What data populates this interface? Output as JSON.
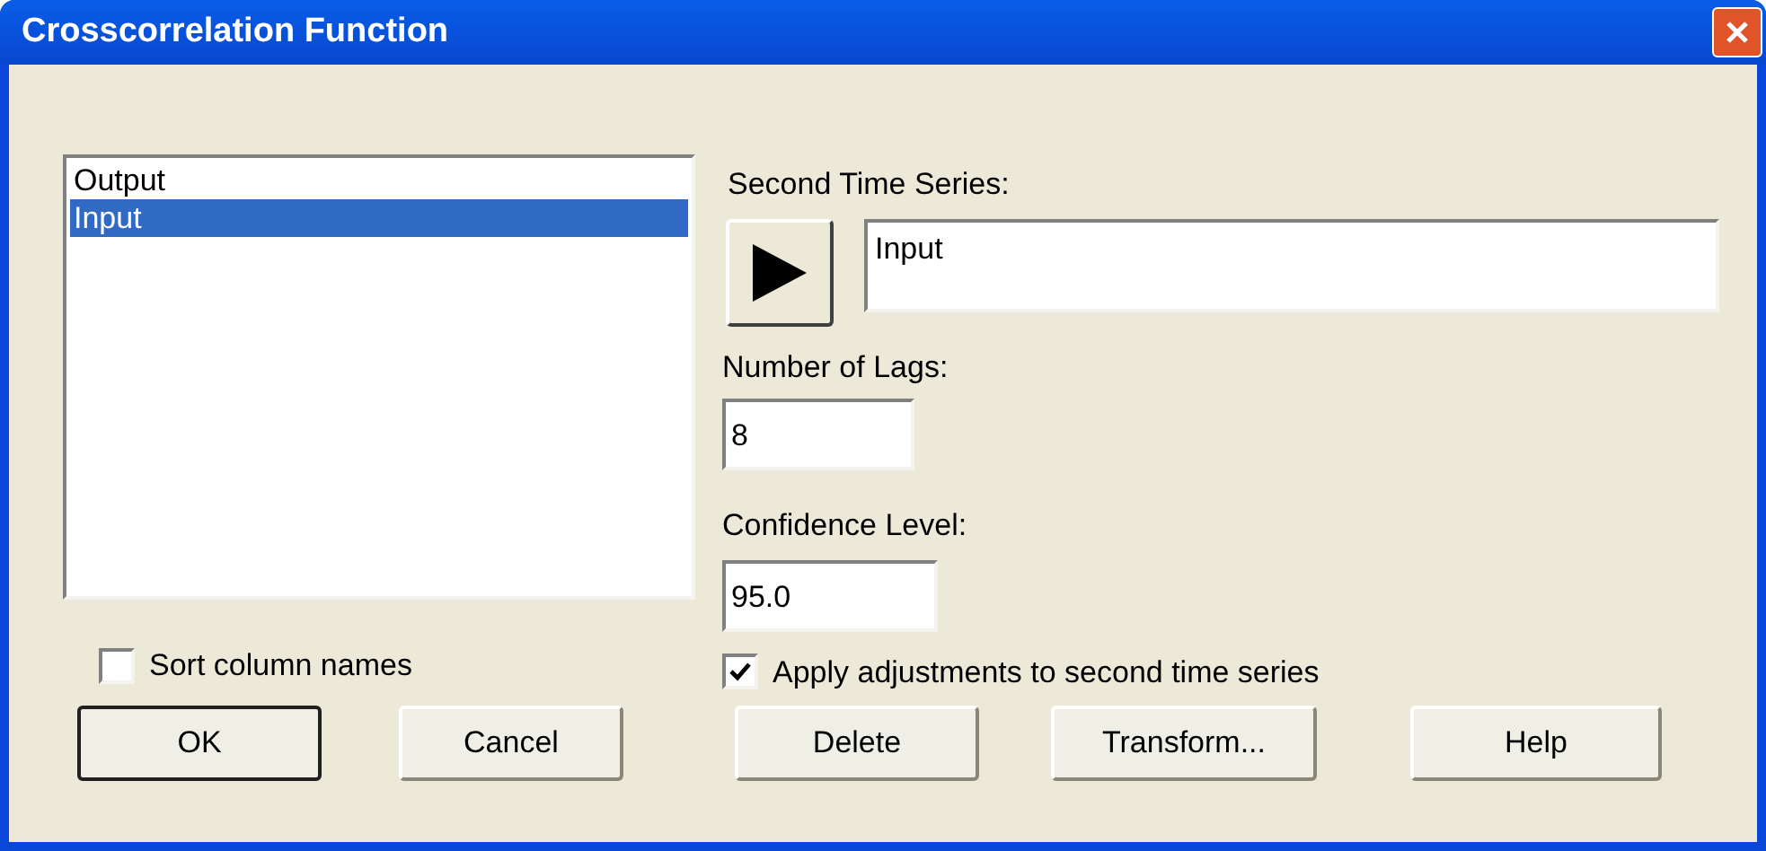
{
  "window": {
    "title": "Crosscorrelation Function"
  },
  "column_list": [
    {
      "label": "Output",
      "selected": false
    },
    {
      "label": "Input",
      "selected": true
    }
  ],
  "sort_column_names": {
    "label": "Sort column names",
    "checked": false
  },
  "second_time_series": {
    "label": "Second Time Series:",
    "value": "Input"
  },
  "number_of_lags": {
    "label": "Number of Lags:",
    "value": "8"
  },
  "confidence_level": {
    "label": "Confidence Level:",
    "value": "95.0"
  },
  "apply_adjustments": {
    "label": "Apply adjustments to second time series",
    "checked": true
  },
  "buttons": [
    {
      "label": "OK",
      "default": true
    },
    {
      "label": "Cancel",
      "default": false
    },
    {
      "label": "Delete",
      "default": false
    },
    {
      "label": "Transform...",
      "default": false
    },
    {
      "label": "Help",
      "default": false
    }
  ]
}
